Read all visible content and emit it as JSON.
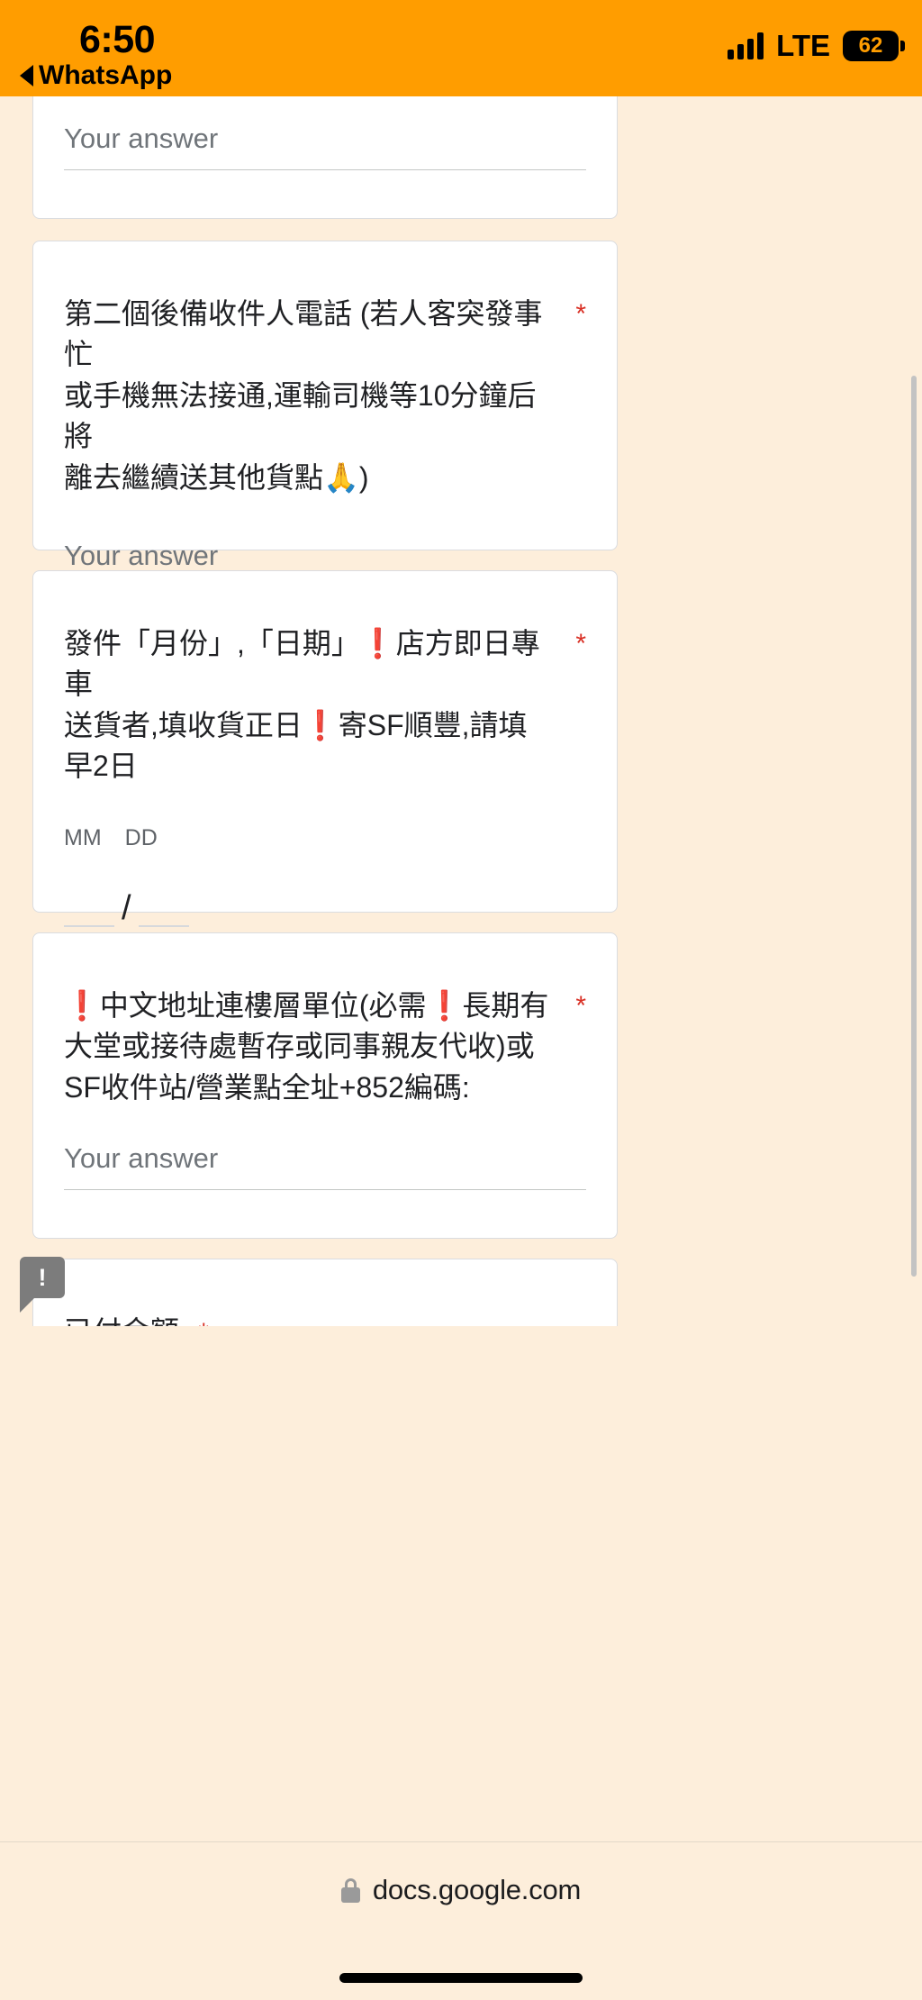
{
  "status_bar": {
    "time": "6:50",
    "back_app": "WhatsApp",
    "network": "LTE",
    "battery": "62",
    "background_color": "#FF9D00"
  },
  "page": {
    "background_color": "#fdeedb",
    "card_background": "#ffffff",
    "required_marker_color": "#d93025"
  },
  "form": {
    "cards": [
      {
        "id": "card-answer-top",
        "question": "",
        "required_marker": "",
        "answer_placeholder": "Your answer"
      },
      {
        "id": "card-backup-phone",
        "question": "第二個後備收件人電話 (若人客突發事忙或手機無法接通,運輸司機等10分鐘后將離去繼續送其他貨點🙏)",
        "question_lines": [
          "第二個後備收件人電話 (若人客突發事忙",
          "或手機無法接通,運輸司機等10分鐘后將",
          "離去繼續送其他貨點🙏)"
        ],
        "required_marker": "*",
        "answer_placeholder": "Your answer"
      },
      {
        "id": "card-ship-date",
        "question": "發件「月份」,「日期」❗店方即日專車送貨者,填收貨正日❗寄SF順豐,請填早2日",
        "question_lines": [
          "發件「月份」,「日期」❗店方即日專車",
          "送貨者,填收貨正日❗寄SF順豐,請填",
          "早2日"
        ],
        "required_marker": "*",
        "date_labels": {
          "month": "MM",
          "day": "DD"
        },
        "date_separator": "/",
        "date_month_value": "",
        "date_day_value": ""
      },
      {
        "id": "card-chinese-address",
        "question": "❗中文地址連樓層單位(必需❗長期有大堂或接待處暫存或同事親友代收)或SF收件站/營業點全址+852編碼:",
        "question_lines": [
          "❗中文地址連樓層單位(必需❗長期有",
          "大堂或接待處暫存或同事親友代收)或",
          "SF收件站/營業點全址+852編碼:"
        ],
        "required_marker": "*",
        "answer_placeholder": "Your answer"
      },
      {
        "id": "card-amount-paid",
        "question": "已付金額:",
        "required_marker": "*",
        "badge_icon": "comment-alert-icon"
      }
    ]
  },
  "browser_bar": {
    "lock_icon": "lock-icon",
    "url": "docs.google.com"
  }
}
